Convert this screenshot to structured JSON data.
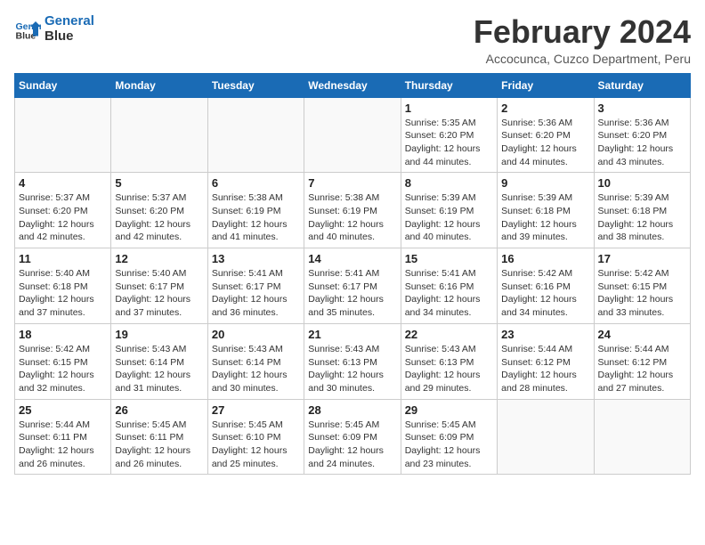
{
  "logo": {
    "line1": "General",
    "line2": "Blue"
  },
  "title": "February 2024",
  "subtitle": "Accocunca, Cuzco Department, Peru",
  "headers": [
    "Sunday",
    "Monday",
    "Tuesday",
    "Wednesday",
    "Thursday",
    "Friday",
    "Saturday"
  ],
  "weeks": [
    [
      {
        "day": "",
        "info": ""
      },
      {
        "day": "",
        "info": ""
      },
      {
        "day": "",
        "info": ""
      },
      {
        "day": "",
        "info": ""
      },
      {
        "day": "1",
        "info": "Sunrise: 5:35 AM\nSunset: 6:20 PM\nDaylight: 12 hours\nand 44 minutes."
      },
      {
        "day": "2",
        "info": "Sunrise: 5:36 AM\nSunset: 6:20 PM\nDaylight: 12 hours\nand 44 minutes."
      },
      {
        "day": "3",
        "info": "Sunrise: 5:36 AM\nSunset: 6:20 PM\nDaylight: 12 hours\nand 43 minutes."
      }
    ],
    [
      {
        "day": "4",
        "info": "Sunrise: 5:37 AM\nSunset: 6:20 PM\nDaylight: 12 hours\nand 42 minutes."
      },
      {
        "day": "5",
        "info": "Sunrise: 5:37 AM\nSunset: 6:20 PM\nDaylight: 12 hours\nand 42 minutes."
      },
      {
        "day": "6",
        "info": "Sunrise: 5:38 AM\nSunset: 6:19 PM\nDaylight: 12 hours\nand 41 minutes."
      },
      {
        "day": "7",
        "info": "Sunrise: 5:38 AM\nSunset: 6:19 PM\nDaylight: 12 hours\nand 40 minutes."
      },
      {
        "day": "8",
        "info": "Sunrise: 5:39 AM\nSunset: 6:19 PM\nDaylight: 12 hours\nand 40 minutes."
      },
      {
        "day": "9",
        "info": "Sunrise: 5:39 AM\nSunset: 6:18 PM\nDaylight: 12 hours\nand 39 minutes."
      },
      {
        "day": "10",
        "info": "Sunrise: 5:39 AM\nSunset: 6:18 PM\nDaylight: 12 hours\nand 38 minutes."
      }
    ],
    [
      {
        "day": "11",
        "info": "Sunrise: 5:40 AM\nSunset: 6:18 PM\nDaylight: 12 hours\nand 37 minutes."
      },
      {
        "day": "12",
        "info": "Sunrise: 5:40 AM\nSunset: 6:17 PM\nDaylight: 12 hours\nand 37 minutes."
      },
      {
        "day": "13",
        "info": "Sunrise: 5:41 AM\nSunset: 6:17 PM\nDaylight: 12 hours\nand 36 minutes."
      },
      {
        "day": "14",
        "info": "Sunrise: 5:41 AM\nSunset: 6:17 PM\nDaylight: 12 hours\nand 35 minutes."
      },
      {
        "day": "15",
        "info": "Sunrise: 5:41 AM\nSunset: 6:16 PM\nDaylight: 12 hours\nand 34 minutes."
      },
      {
        "day": "16",
        "info": "Sunrise: 5:42 AM\nSunset: 6:16 PM\nDaylight: 12 hours\nand 34 minutes."
      },
      {
        "day": "17",
        "info": "Sunrise: 5:42 AM\nSunset: 6:15 PM\nDaylight: 12 hours\nand 33 minutes."
      }
    ],
    [
      {
        "day": "18",
        "info": "Sunrise: 5:42 AM\nSunset: 6:15 PM\nDaylight: 12 hours\nand 32 minutes."
      },
      {
        "day": "19",
        "info": "Sunrise: 5:43 AM\nSunset: 6:14 PM\nDaylight: 12 hours\nand 31 minutes."
      },
      {
        "day": "20",
        "info": "Sunrise: 5:43 AM\nSunset: 6:14 PM\nDaylight: 12 hours\nand 30 minutes."
      },
      {
        "day": "21",
        "info": "Sunrise: 5:43 AM\nSunset: 6:13 PM\nDaylight: 12 hours\nand 30 minutes."
      },
      {
        "day": "22",
        "info": "Sunrise: 5:43 AM\nSunset: 6:13 PM\nDaylight: 12 hours\nand 29 minutes."
      },
      {
        "day": "23",
        "info": "Sunrise: 5:44 AM\nSunset: 6:12 PM\nDaylight: 12 hours\nand 28 minutes."
      },
      {
        "day": "24",
        "info": "Sunrise: 5:44 AM\nSunset: 6:12 PM\nDaylight: 12 hours\nand 27 minutes."
      }
    ],
    [
      {
        "day": "25",
        "info": "Sunrise: 5:44 AM\nSunset: 6:11 PM\nDaylight: 12 hours\nand 26 minutes."
      },
      {
        "day": "26",
        "info": "Sunrise: 5:45 AM\nSunset: 6:11 PM\nDaylight: 12 hours\nand 26 minutes."
      },
      {
        "day": "27",
        "info": "Sunrise: 5:45 AM\nSunset: 6:10 PM\nDaylight: 12 hours\nand 25 minutes."
      },
      {
        "day": "28",
        "info": "Sunrise: 5:45 AM\nSunset: 6:09 PM\nDaylight: 12 hours\nand 24 minutes."
      },
      {
        "day": "29",
        "info": "Sunrise: 5:45 AM\nSunset: 6:09 PM\nDaylight: 12 hours\nand 23 minutes."
      },
      {
        "day": "",
        "info": ""
      },
      {
        "day": "",
        "info": ""
      }
    ]
  ]
}
